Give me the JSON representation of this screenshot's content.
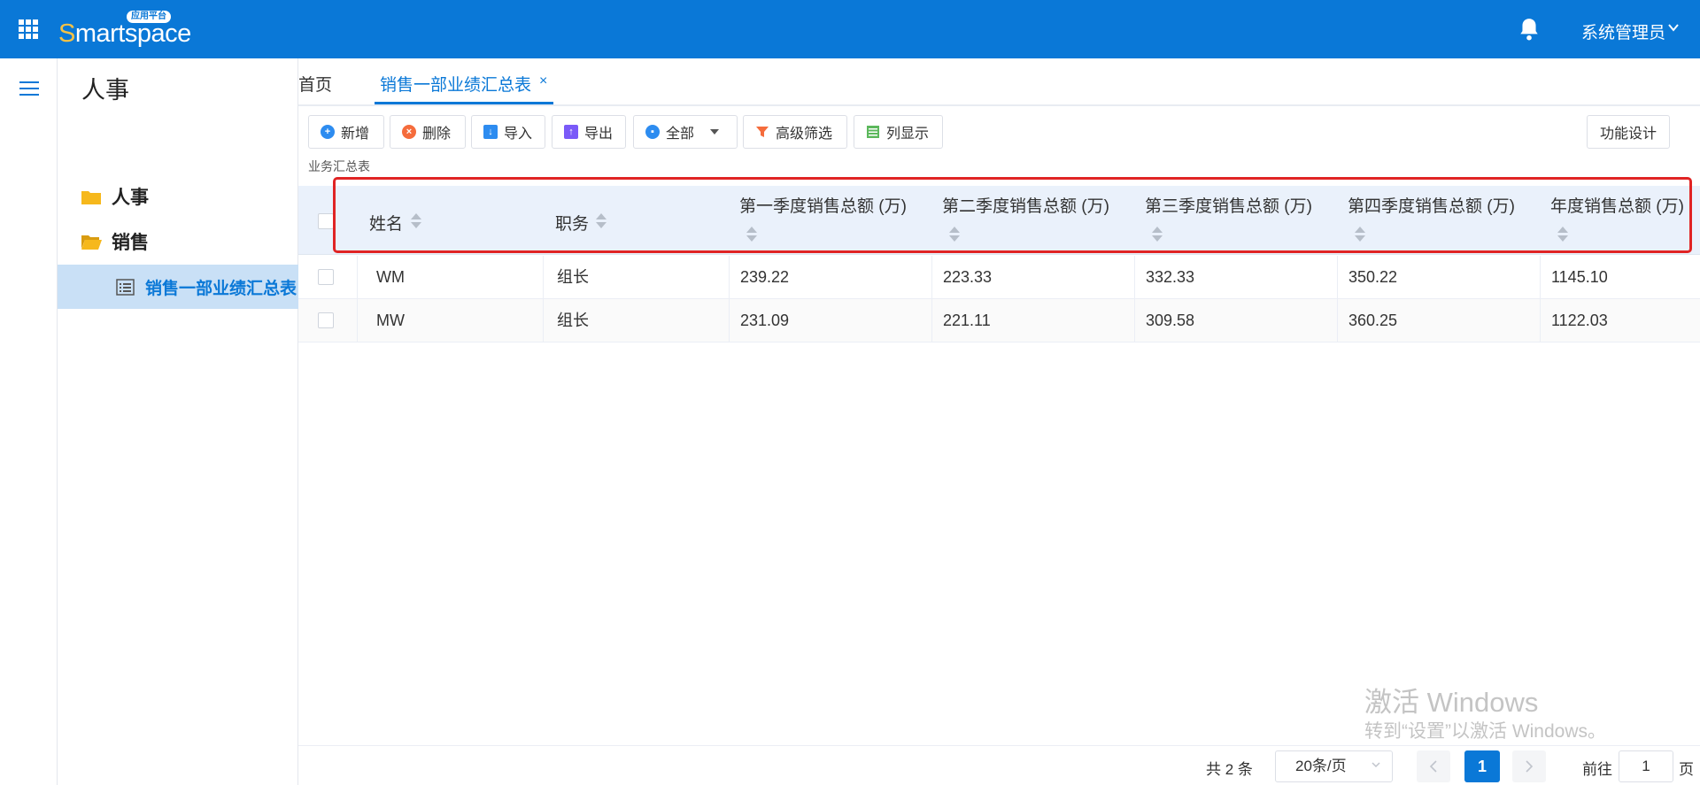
{
  "header": {
    "logo_first": "S",
    "logo_rest": "martspace",
    "logo_badge": "应用平台",
    "user_name": "系统管理员"
  },
  "tree": {
    "title": "人事",
    "items": [
      {
        "label": "人事"
      },
      {
        "label": "销售"
      },
      {
        "label": "销售一部业绩汇总表"
      }
    ]
  },
  "tabs": {
    "home": "首页",
    "active": "销售一部业绩汇总表",
    "close": "×"
  },
  "toolbar": {
    "add": "新增",
    "delete": "删除",
    "import": "导入",
    "export": "导出",
    "scope": "全部",
    "advanced_filter": "高级筛选",
    "columns": "列显示",
    "design": "功能设计"
  },
  "section_title": "业务汇总表",
  "table": {
    "columns": [
      "姓名",
      "职务",
      "第一季度销售总额 (万)",
      "第二季度销售总额 (万)",
      "第三季度销售总额 (万)",
      "第四季度销售总额 (万)",
      "年度销售总额 (万)"
    ],
    "rows": [
      [
        "WM",
        "组长",
        "239.22",
        "223.33",
        "332.33",
        "350.22",
        "1145.10"
      ],
      [
        "MW",
        "组长",
        "231.09",
        "221.11",
        "309.58",
        "360.25",
        "1122.03"
      ]
    ]
  },
  "watermark": {
    "line1": "激活 Windows",
    "line2": "转到“设置”以激活 Windows。"
  },
  "pagination": {
    "total": "共 2 条",
    "page_size": "20条/页",
    "current_page": "1",
    "goto_label": "前往",
    "goto_value": "1",
    "page_suffix": "页"
  },
  "colors": {
    "primary": "#0a78d7",
    "header_bg": "#eaf1fb",
    "highlight": "#e02424"
  }
}
